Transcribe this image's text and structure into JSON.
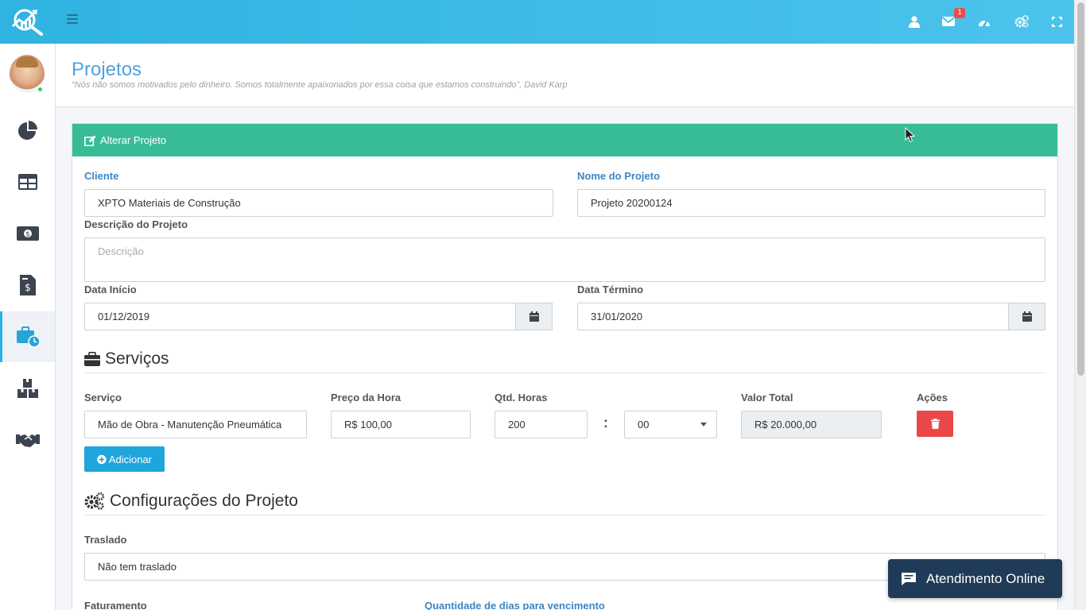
{
  "topbar": {
    "notification_count": "1",
    "icons": [
      "user-icon",
      "envelope-icon",
      "dashboard-icon",
      "cogs-icon",
      "fullscreen-icon"
    ]
  },
  "sidebar": {
    "items": [
      {
        "icon": "pie-chart-icon"
      },
      {
        "icon": "table-icon"
      },
      {
        "icon": "money-icon"
      },
      {
        "icon": "invoice-icon"
      },
      {
        "icon": "briefcase-clock-icon",
        "active": true
      },
      {
        "icon": "boxes-icon"
      },
      {
        "icon": "handshake-icon"
      }
    ]
  },
  "page": {
    "title": "Projetos",
    "quote": "“Nós não somos motivados pelo dinheiro. Somos totalmente apaixonados por essa coisa que estamos construindo”, David Karp"
  },
  "form": {
    "header": "Alterar Projeto",
    "cliente_label": "Cliente",
    "cliente_value": "XPTO Materiais de Construção",
    "nome_label": "Nome do Projeto",
    "nome_value": "Projeto 20200124",
    "descricao_label": "Descrição do Projeto",
    "descricao_placeholder": "Descrição",
    "inicio_label": "Data Início",
    "inicio_value": "01/12/2019",
    "termino_label": "Data Término",
    "termino_value": "31/01/2020"
  },
  "servicos": {
    "title": "Serviços",
    "servico_label": "Serviço",
    "preco_label": "Preço da Hora",
    "qtd_label": "Qtd. Horas",
    "valor_label": "Valor Total",
    "acoes_label": "Ações",
    "row": {
      "servico": "Mão de Obra - Manutenção Pneumática",
      "preco": "R$ 100,00",
      "horas": "200",
      "separator": ":",
      "minutos": "00",
      "valor_total": "R$ 20.000,00"
    },
    "add_label": "Adicionar"
  },
  "config": {
    "title": "Configurações do Projeto",
    "traslado_label": "Traslado",
    "traslado_value": "Não tem traslado",
    "faturamento_label": "Faturamento",
    "dias_label": "Quantidade de dias para vencimento"
  },
  "chat": {
    "label": "Atendimento Online"
  },
  "colors": {
    "topbar": "#2fb3e0",
    "card_header": "#38bc98",
    "delete": "#ea4848",
    "add": "#1ea6dc",
    "chat": "#1f3b57",
    "title": "#4da3db"
  }
}
